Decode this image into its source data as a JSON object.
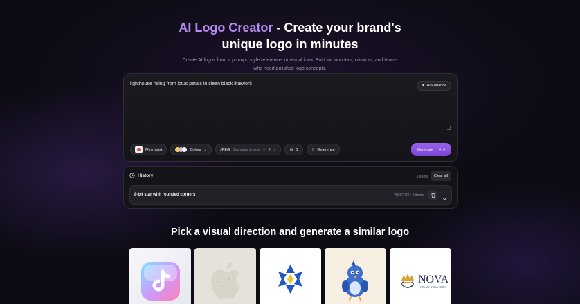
{
  "hero": {
    "title_accent": "AI Logo Creator",
    "title_rest": " - Create your brand's",
    "title_line2": "unique logo in minutes",
    "subtitle_line1": "Create AI logos from a prompt, style reference, or visual idea. Built for founders, creators, and teams",
    "subtitle_line2": "who need polished logo concepts."
  },
  "prompt": {
    "value": "lighthouse rising from lotus petals in clean black linework",
    "enhance_label": "AI Enhance"
  },
  "toolbar": {
    "style_label": "Minimalist",
    "colors_label": "Colors",
    "format_label": "JPEG",
    "quality_label": "Standard image",
    "cost_value": "4",
    "count_value": "1",
    "reference_label": "Reference",
    "generate_label": "Generate",
    "generate_cost": "4"
  },
  "history": {
    "title": "History",
    "count": "1 items",
    "clear_label": "Clear all",
    "items": [
      {
        "title": "8-bit star with rounded corners",
        "meta": "2026/7/20 · 1 items"
      }
    ]
  },
  "gallery": {
    "title": "Pick a visual direction and generate a similar logo",
    "nova_name": "NOVA",
    "nova_tagline": "PRIME FOUNDRY"
  },
  "colors": {
    "accent": "#9a63ee",
    "accent_text": "#b68cf2",
    "background": "#0d0b14"
  }
}
